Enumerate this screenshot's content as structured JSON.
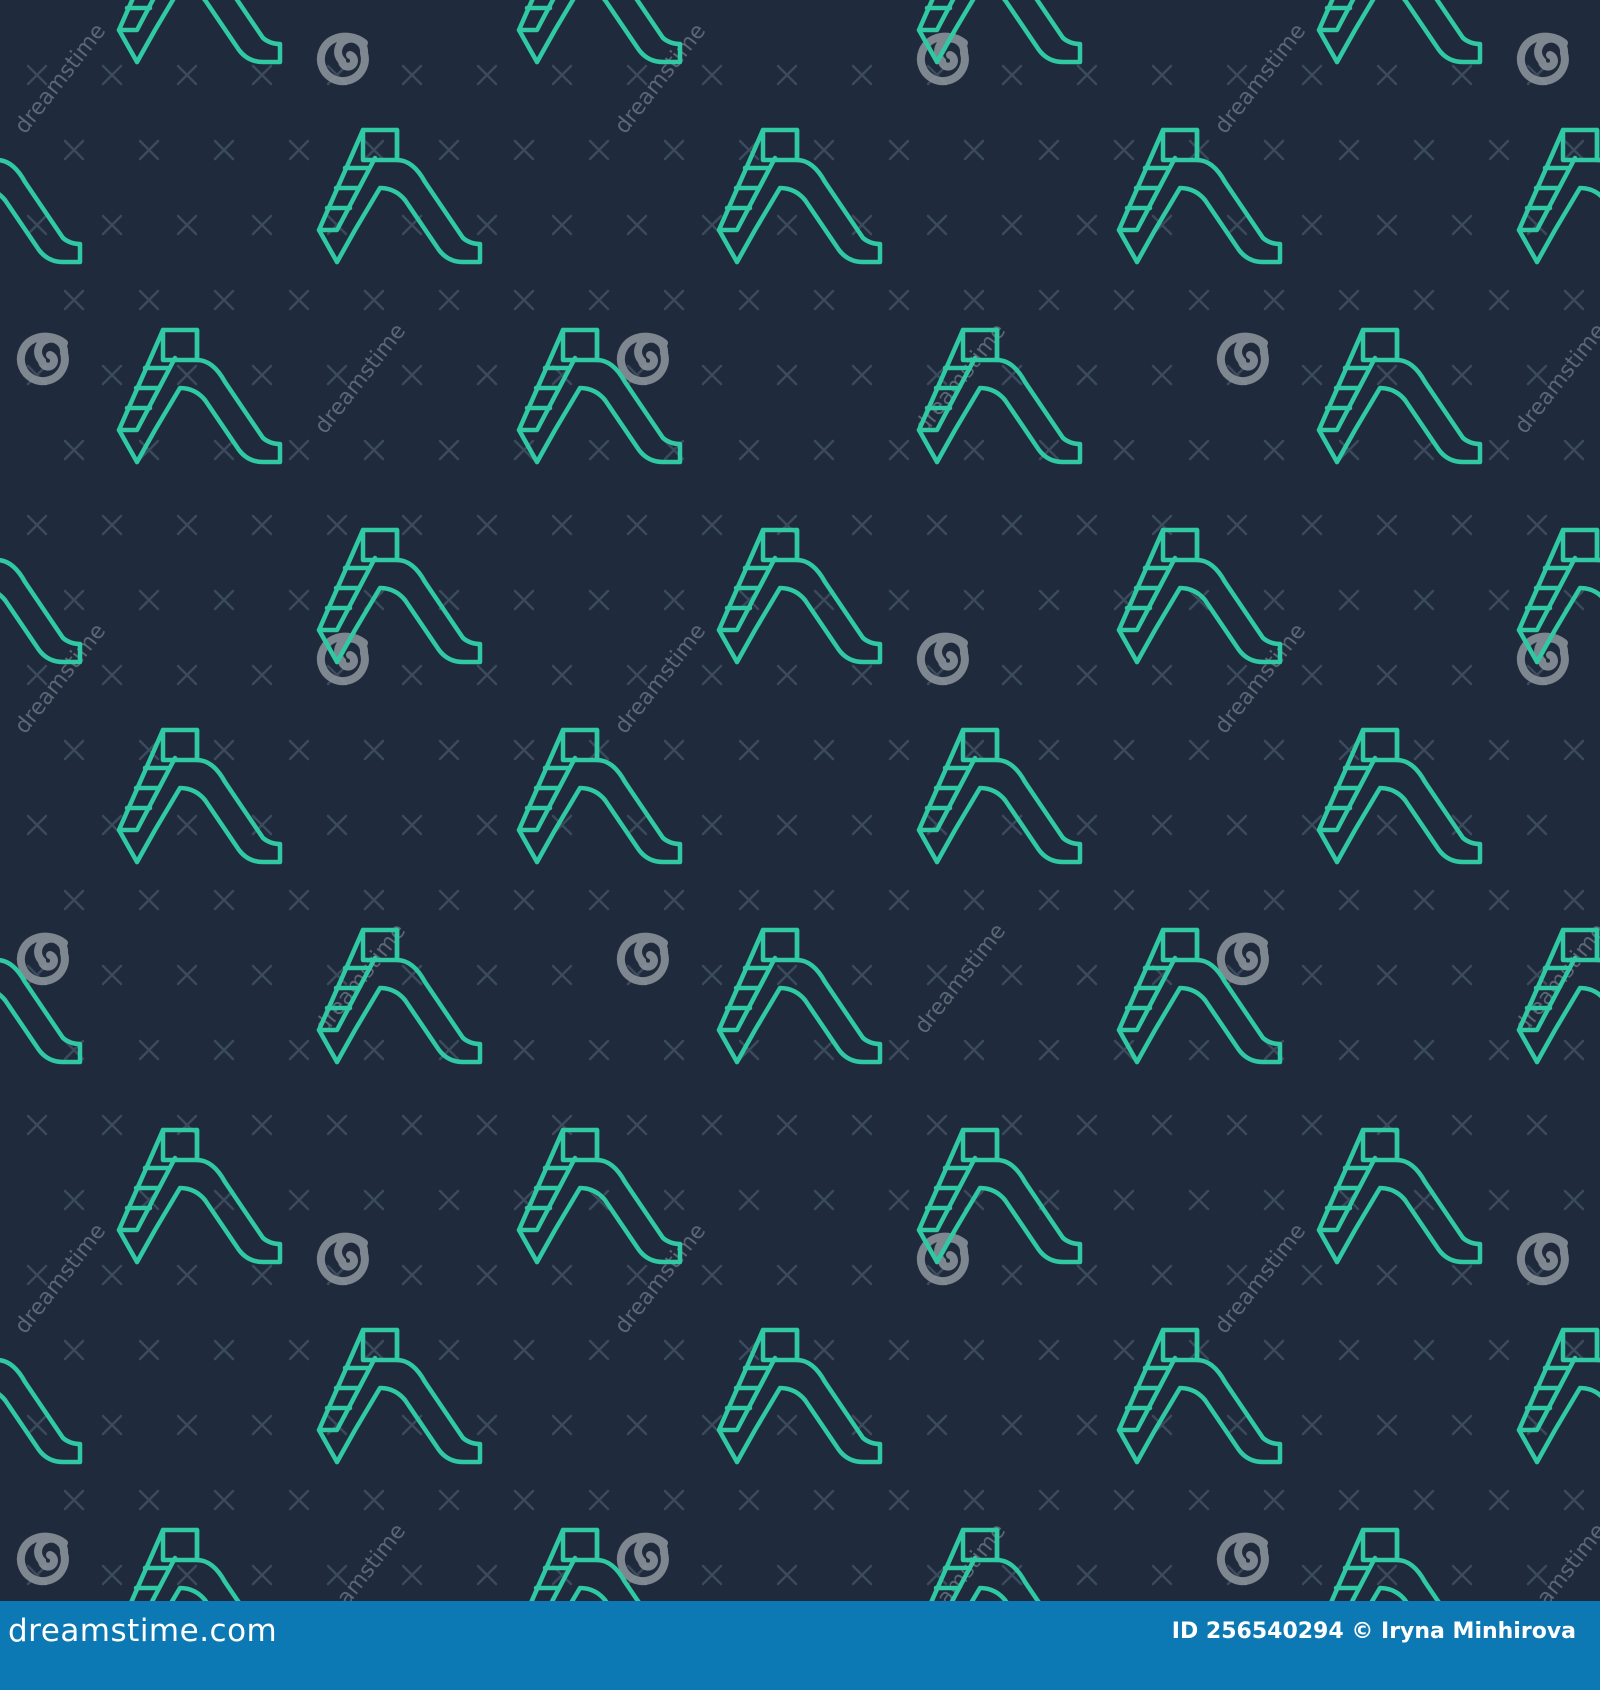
{
  "pattern": {
    "icon_name": "slide-icon",
    "icon_color": "#30c9a3",
    "background_color": "#1f2b3c",
    "cross_color": "#3b4a5c",
    "spiral_color": "#8f969e",
    "watermark_color": "#6b7683",
    "watermark_text": "dreamstime"
  },
  "footer": {
    "background_color": "#0d79b4",
    "site_label": "dreamstime.com",
    "id_label": "ID 256540294",
    "credit_label": "© Iryna Minhirova"
  }
}
